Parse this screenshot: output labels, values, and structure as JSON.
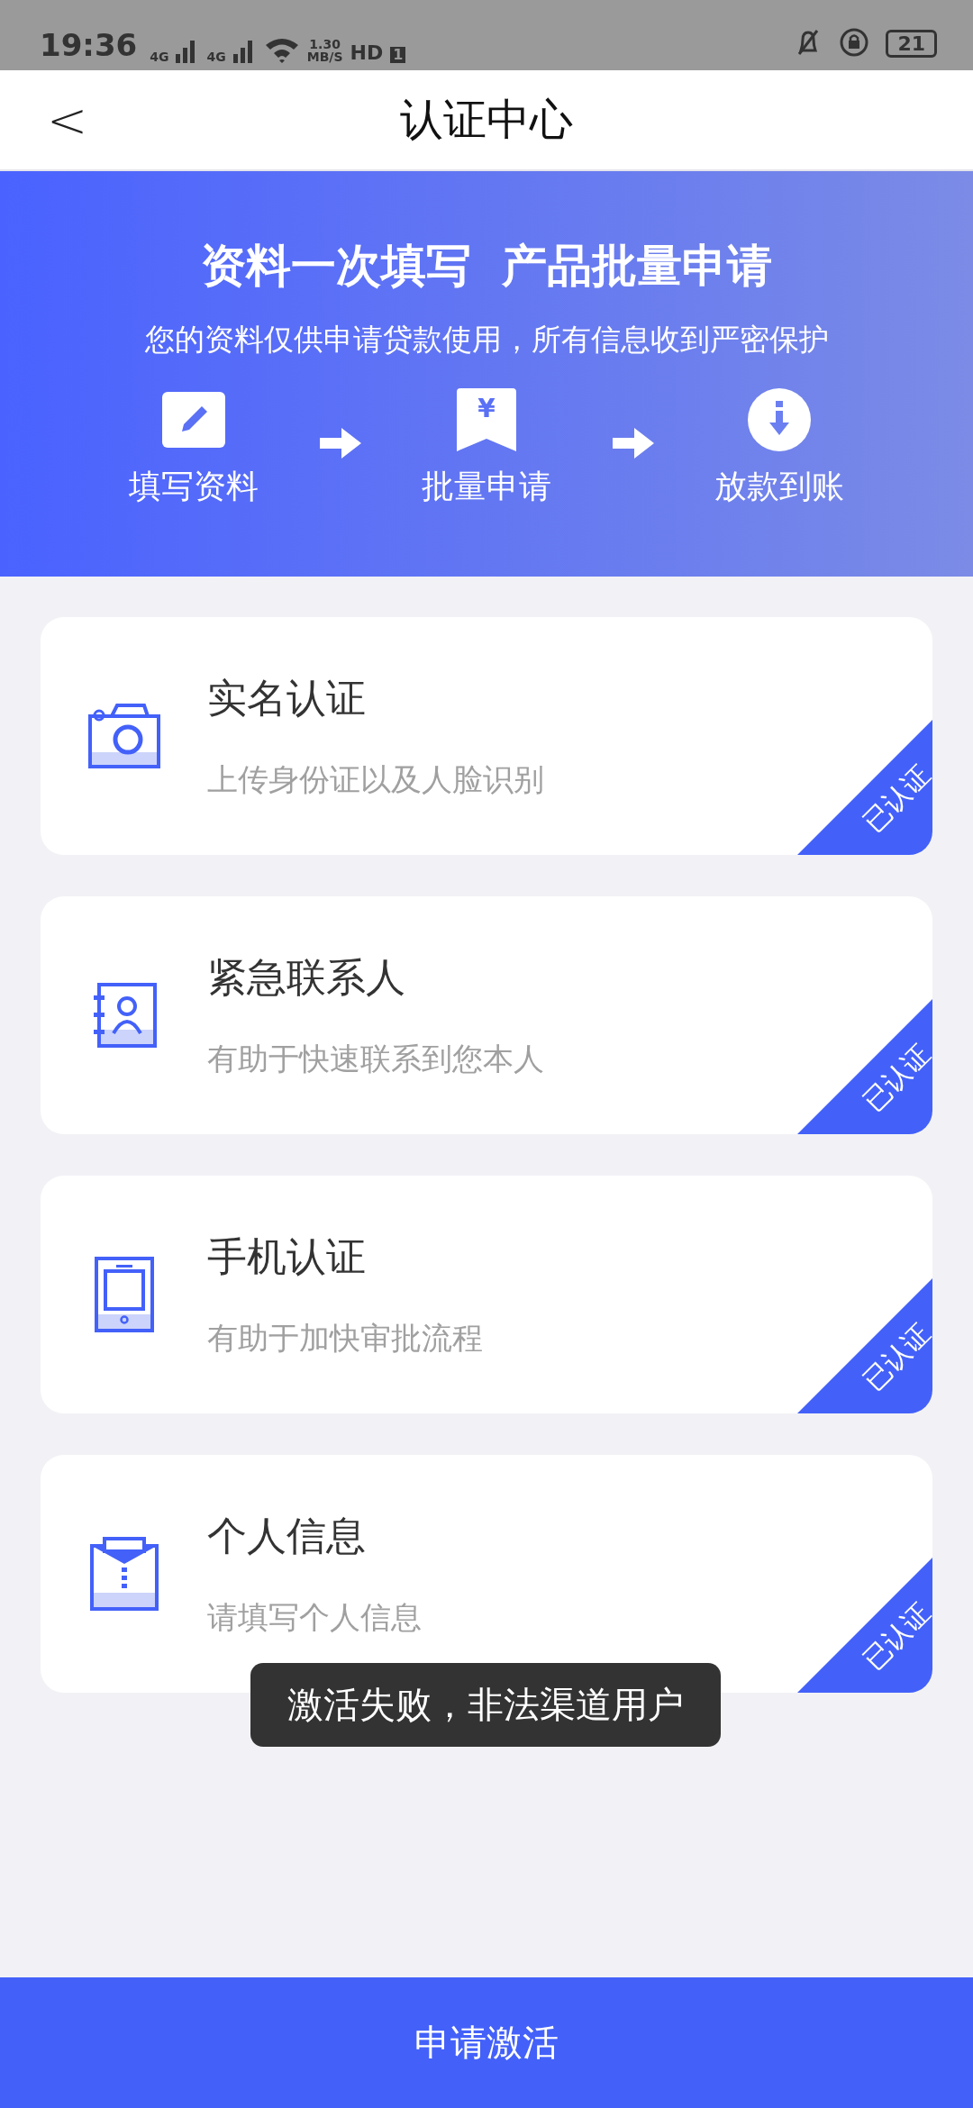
{
  "status_bar": {
    "time": "19:36",
    "network_1": "4G",
    "network_2": "4G",
    "speed_value": "1.30",
    "speed_unit": "MB/S",
    "hd_label": "HD",
    "hd_index": "1",
    "battery": "21"
  },
  "header": {
    "back": "<",
    "title": "认证中心"
  },
  "banner": {
    "headline": "资料一次填写  产品批量申请",
    "subtitle": "您的资料仅供申请贷款使用，所有信息收到严密保护",
    "steps": [
      {
        "kind": "edit",
        "label": "填写资料"
      },
      {
        "kind": "bookmark",
        "label": "批量申请",
        "glyph": "¥"
      },
      {
        "kind": "download",
        "label": "放款到账"
      }
    ]
  },
  "cards": [
    {
      "kind": "camera",
      "title": "实名认证",
      "subtitle": "上传身份证以及人脸识别",
      "verified": true,
      "badge": "已认证"
    },
    {
      "kind": "contacts",
      "title": "紧急联系人",
      "subtitle": "有助于快速联系到您本人",
      "verified": true,
      "badge": "已认证"
    },
    {
      "kind": "tablet",
      "title": "手机认证",
      "subtitle": "有助于加快审批流程",
      "verified": true,
      "badge": "已认证"
    },
    {
      "kind": "clipboard",
      "title": "个人信息",
      "subtitle": "请填写个人信息",
      "verified": true,
      "badge": "已认证"
    }
  ],
  "toast": "激活失败，非法渠道用户",
  "action_button": "申请激活"
}
